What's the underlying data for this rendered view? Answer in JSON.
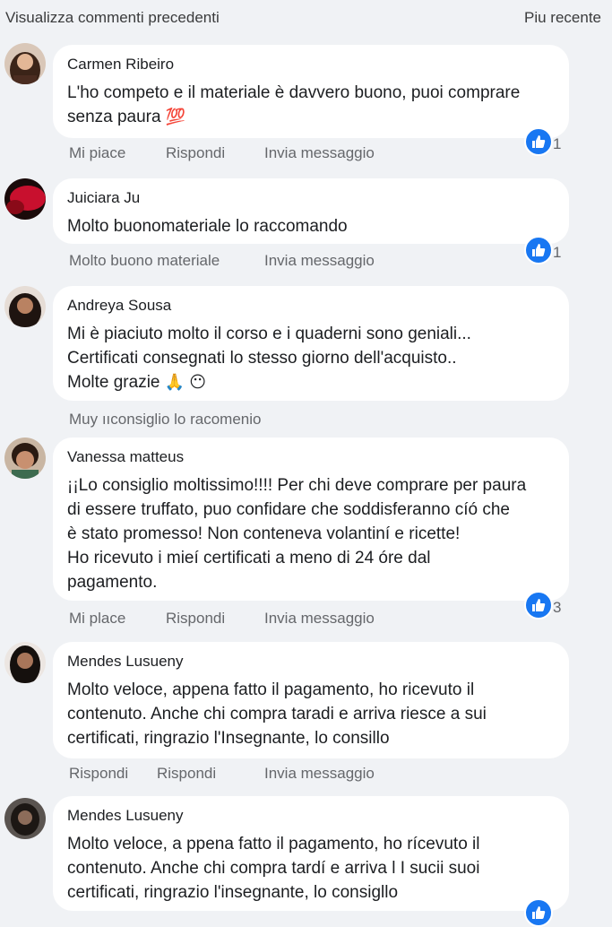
{
  "header": {
    "previous_label": "Visualizza commenti precedenti",
    "sort_label": "Piu recente"
  },
  "comments": [
    {
      "author": "Carmen Ribeiro",
      "lines": [
        "L'ho competo e il materiale è davvero buono, puoi comprare",
        "senza paura"
      ],
      "emoji": "💯",
      "actions": [
        "Mi piace",
        "Rispondi",
        "Invia messaggio"
      ],
      "likes": "1"
    },
    {
      "author": "Juiciara Ju",
      "lines": [
        "Molto buonomateriale lo raccomando"
      ],
      "actions": [
        "Molto buono materiale",
        "Invia messaggio"
      ],
      "likes": "1"
    },
    {
      "author": "Andreya Sousa",
      "lines": [
        "Mi è piaciuto molto il corso e i quaderni sono geniali...",
        "Certificati consegnati lo stesso giorno dell'acquisto..",
        "Molte grazie"
      ],
      "emoji": "🙏 😶",
      "actions": [
        "Muy ııconsiglio lo racomenio"
      ]
    },
    {
      "author": "Vanessa matteus",
      "lines": [
        "¡¡Lo consiglio moltissimo!!!! Per chi deve comprare per paura",
        "di essere truffato, puo confidare che soddisferanno cíó che",
        "è stato promesso! Non conteneva volantiní e ricette!",
        "Ho ricevuto i mieí certificati a meno di 24 óre dal",
        "pagamento."
      ],
      "actions": [
        "Mi place",
        "Rispondi",
        "Invia messaggio"
      ],
      "likes": "3"
    },
    {
      "author": "Mendes Lusueny",
      "lines": [
        "Molto veloce, appena fatto il pagamento, ho ricevuto il",
        "contenuto. Anche chi compra taradi e arriva riesce a sui",
        "certificati, ringrazio l'Insegnante, lo consillo"
      ],
      "actions": [
        "Rispondi",
        "Rispondi",
        "Invia messaggio"
      ]
    },
    {
      "author": "Mendes Lusueny",
      "lines": [
        "Molto veloce, a ppena fatto il pagamento, ho rícevuto il",
        "contenuto. Anche chi compra tardí e arriva l I sucii suoi",
        "certificati, ringrazio l'insegnante, lo consigllo"
      ],
      "actions": []
    }
  ],
  "colors": {
    "like_blue": "#1877f2",
    "background": "#f0f2f5",
    "bubble": "#ffffff",
    "meta_text": "#65676b"
  },
  "icons": {
    "like": "thumbs-up-icon"
  }
}
